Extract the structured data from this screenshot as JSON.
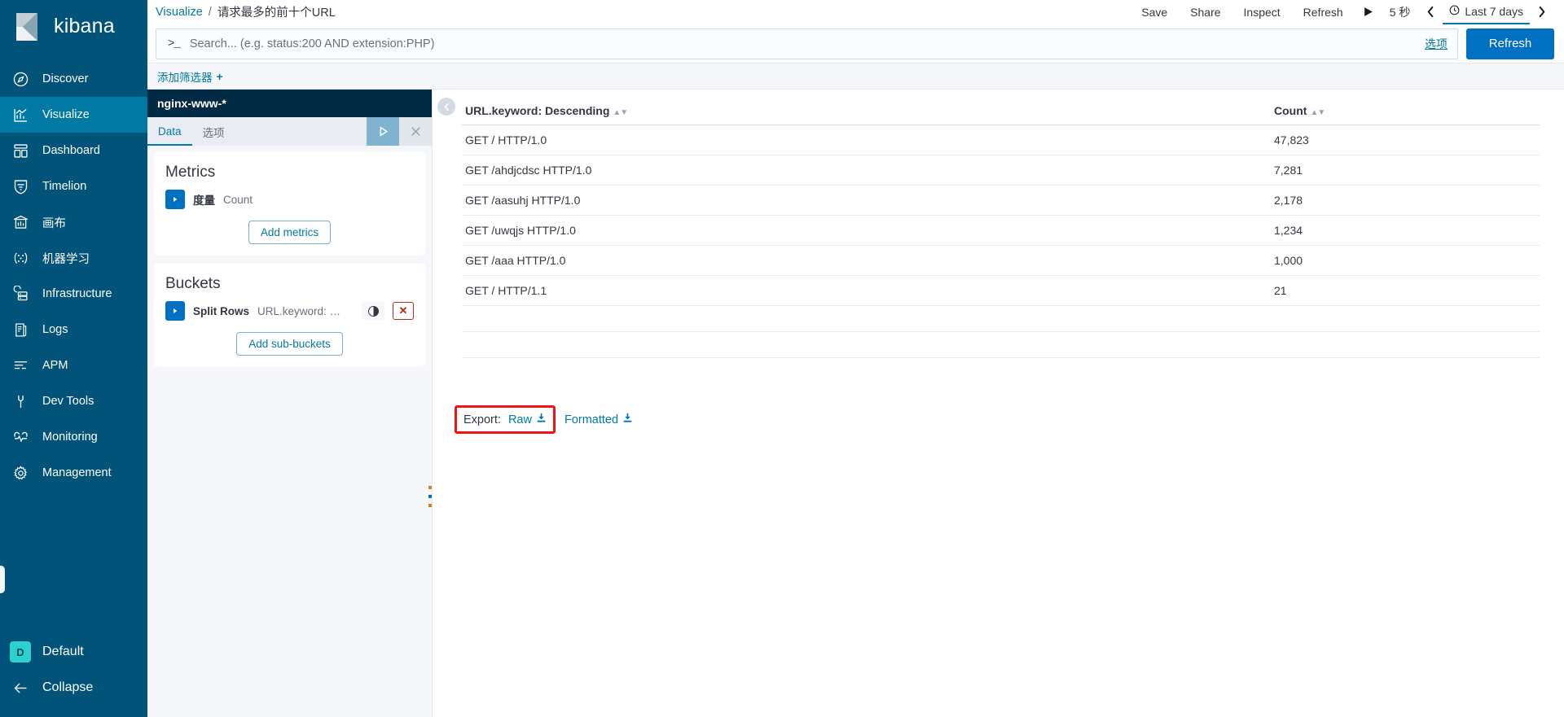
{
  "app": {
    "name": "kibana",
    "logo_icon": "kibana-logo"
  },
  "sidebar": {
    "items": [
      {
        "label": "Discover",
        "icon": "compass-icon",
        "active": false
      },
      {
        "label": "Visualize",
        "icon": "bar-chart-icon",
        "active": true
      },
      {
        "label": "Dashboard",
        "icon": "dashboard-icon",
        "active": false
      },
      {
        "label": "Timelion",
        "icon": "timelion-icon",
        "active": false
      },
      {
        "label": "画布",
        "icon": "canvas-icon",
        "active": false
      },
      {
        "label": "机器学习",
        "icon": "machine-learning-icon",
        "active": false
      },
      {
        "label": "Infrastructure",
        "icon": "infrastructure-icon",
        "active": false
      },
      {
        "label": "Logs",
        "icon": "logs-icon",
        "active": false
      },
      {
        "label": "APM",
        "icon": "apm-icon",
        "active": false
      },
      {
        "label": "Dev Tools",
        "icon": "wrench-icon",
        "active": false
      },
      {
        "label": "Monitoring",
        "icon": "monitoring-icon",
        "active": false
      },
      {
        "label": "Management",
        "icon": "gear-icon",
        "active": false
      }
    ],
    "space": {
      "initial": "D",
      "label": "Default"
    },
    "collapse": {
      "label": "Collapse",
      "icon": "arrow-left-icon"
    }
  },
  "breadcrumb": {
    "root": "Visualize",
    "separator": "/",
    "current": "请求最多的前十个URL"
  },
  "topbar": {
    "save": "Save",
    "share": "Share",
    "inspect": "Inspect",
    "refresh": "Refresh",
    "play_icon": "play-icon",
    "interval": "5 秒",
    "prev_icon": "chevron-left-icon",
    "clock_icon": "clock-icon",
    "date_range": "Last 7 days",
    "next_icon": "chevron-right-icon"
  },
  "search": {
    "prompt": ">_",
    "placeholder": "Search... (e.g. status:200 AND extension:PHP)",
    "value": "",
    "options_link": "选项",
    "refresh_button": "Refresh"
  },
  "filter_bar": {
    "add_filter": "添加筛选器",
    "plus": "+"
  },
  "editor": {
    "index_pattern": "nginx-www-*",
    "tabs": [
      {
        "label": "Data",
        "active": true
      },
      {
        "label": "选项",
        "active": false
      }
    ],
    "apply_icon": "play-triangle-icon",
    "discard_icon": "close-icon",
    "metrics": {
      "title": "Metrics",
      "agg": {
        "label": "度量",
        "value": "Count",
        "expand_icon": "chevron-right-icon"
      },
      "add_button": "Add metrics"
    },
    "buckets": {
      "title": "Buckets",
      "agg": {
        "label": "Split Rows",
        "value": "URL.keyword: Descen...",
        "expand_icon": "chevron-right-icon"
      },
      "toggle_icon": "visibility-toggle",
      "delete_icon": "remove-icon",
      "add_button": "Add sub-buckets"
    }
  },
  "viz": {
    "collapse_icon": "chevron-left-circle-icon",
    "table": {
      "columns": [
        {
          "label": "URL.keyword: Descending",
          "sort_icon": "sort-icon"
        },
        {
          "label": "Count",
          "sort_icon": "sort-icon"
        }
      ],
      "rows": [
        {
          "url": "GET / HTTP/1.0",
          "count": "47,823"
        },
        {
          "url": "GET /ahdjcdsc HTTP/1.0",
          "count": "7,281"
        },
        {
          "url": "GET /aasuhj HTTP/1.0",
          "count": "2,178"
        },
        {
          "url": "GET /uwqjs HTTP/1.0",
          "count": "1,234"
        },
        {
          "url": "GET /aaa HTTP/1.0",
          "count": "1,000"
        },
        {
          "url": "GET / HTTP/1.1",
          "count": "21"
        }
      ],
      "blank_rows": 2
    },
    "export": {
      "label": "Export:",
      "raw": "Raw",
      "formatted": "Formatted",
      "download_icon": "download-icon",
      "highlight_color": "#f01414"
    }
  },
  "chart_data": {
    "type": "table",
    "title": "请求最多的前十个URL",
    "columns": [
      "URL.keyword: Descending",
      "Count"
    ],
    "categories": [
      "GET / HTTP/1.0",
      "GET /ahdjcdsc HTTP/1.0",
      "GET /aasuhj HTTP/1.0",
      "GET /uwqjs HTTP/1.0",
      "GET /aaa HTTP/1.0",
      "GET / HTTP/1.1"
    ],
    "values": [
      47823,
      7281,
      2178,
      1234,
      1000,
      21
    ],
    "xlabel": "URL.keyword: Descending",
    "ylabel": "Count",
    "metric": "Count",
    "bucket": "Split Rows URL.keyword: Descending",
    "index_pattern": "nginx-www-*",
    "time_range": "Last 7 days"
  },
  "colors": {
    "sidebar_bg": "#015379",
    "sidebar_active": "#0079a5",
    "index_header_bg": "#012b44",
    "primary": "#0071c2",
    "link": "#0079a5",
    "danger": "#bd271e",
    "space_badge": "#2dcfcf",
    "highlight": "#f01414"
  }
}
